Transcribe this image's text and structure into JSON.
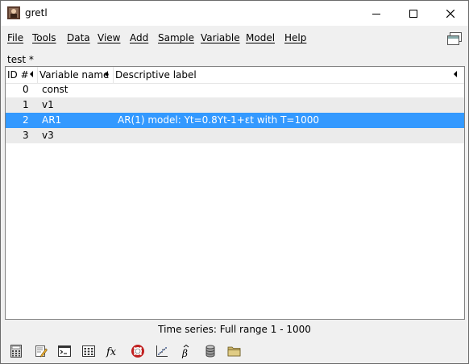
{
  "window": {
    "title": "gretl",
    "colors": {
      "selection": "#3399ff",
      "alt_row": "#ebebeb"
    }
  },
  "menu": {
    "items": [
      "File",
      "Tools",
      "Data",
      "View",
      "Add",
      "Sample",
      "Variable",
      "Model",
      "Help"
    ]
  },
  "dataset": {
    "name": "test *"
  },
  "table": {
    "headers": {
      "id": "ID #",
      "name": "Variable name",
      "label": "Descriptive label"
    },
    "rows": [
      {
        "id": "0",
        "name": "const",
        "label": ""
      },
      {
        "id": "1",
        "name": "v1",
        "label": ""
      },
      {
        "id": "2",
        "name": "AR1",
        "label": "AR(1) model: Yt=0.8Yt-1+εt   with T=1000",
        "selected": true
      },
      {
        "id": "3",
        "name": "v3",
        "label": ""
      }
    ]
  },
  "status": {
    "text": "Time series: Full range 1 - 1000"
  },
  "toolbar": {
    "icons": [
      "calculator-icon",
      "edit-icon",
      "terminal-icon",
      "matrix-icon",
      "function-fx-icon",
      "help-lifebuoy-icon",
      "scatter-plot-icon",
      "beta-hat-icon",
      "database-icon",
      "folder-icon"
    ]
  }
}
